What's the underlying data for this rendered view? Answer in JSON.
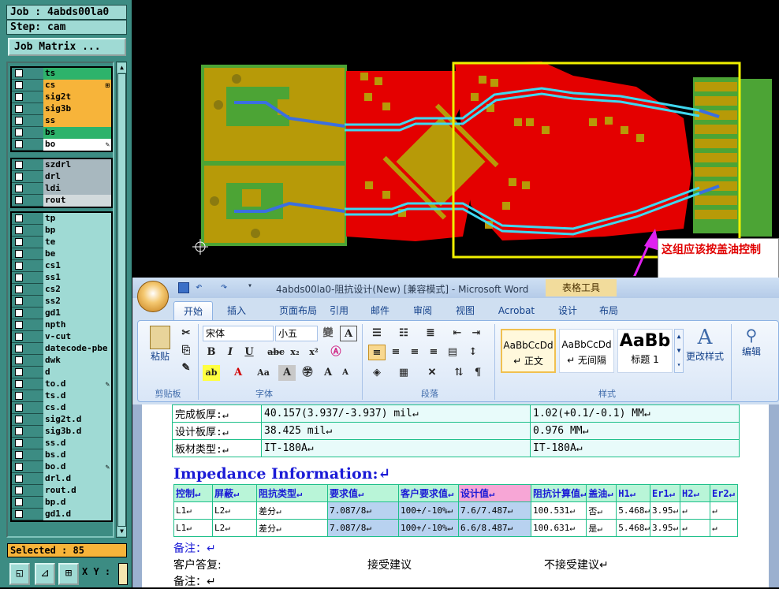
{
  "cam": {
    "job_label": "Job : 4abds00la0",
    "step_label": "Step: cam",
    "job_matrix_label": "Job Matrix ...",
    "layer_groups": [
      [
        {
          "name": "ts",
          "color": "#2db36b",
          "mark": ""
        },
        {
          "name": "cs",
          "color": "#f7b43a",
          "mark": "⊞"
        },
        {
          "name": "sig2t",
          "color": "#f7b43a",
          "mark": ""
        },
        {
          "name": "sig3b",
          "color": "#f7b43a",
          "mark": ""
        },
        {
          "name": "ss",
          "color": "#f7b43a",
          "mark": ""
        },
        {
          "name": "bs",
          "color": "#2db36b",
          "mark": ""
        },
        {
          "name": "bo",
          "color": "#ffffff",
          "mark": "✎"
        }
      ],
      [
        {
          "name": "szdrl",
          "color": "#a8b8bf",
          "mark": ""
        },
        {
          "name": "drl",
          "color": "#a8b8bf",
          "mark": ""
        },
        {
          "name": "ldi",
          "color": "#a8b8bf",
          "mark": ""
        },
        {
          "name": "rout",
          "color": "#d2dadc",
          "mark": ""
        }
      ],
      [
        {
          "name": "tp",
          "color": "#9fdad4",
          "mark": ""
        },
        {
          "name": "bp",
          "color": "#9fdad4",
          "mark": ""
        },
        {
          "name": "te",
          "color": "#9fdad4",
          "mark": ""
        },
        {
          "name": "be",
          "color": "#9fdad4",
          "mark": ""
        },
        {
          "name": "cs1",
          "color": "#9fdad4",
          "mark": ""
        },
        {
          "name": "ss1",
          "color": "#9fdad4",
          "mark": ""
        },
        {
          "name": "cs2",
          "color": "#9fdad4",
          "mark": ""
        },
        {
          "name": "ss2",
          "color": "#9fdad4",
          "mark": ""
        },
        {
          "name": "gd1",
          "color": "#9fdad4",
          "mark": ""
        },
        {
          "name": "npth",
          "color": "#9fdad4",
          "mark": ""
        },
        {
          "name": "v-cut",
          "color": "#9fdad4",
          "mark": ""
        },
        {
          "name": "datecode-pbe",
          "color": "#9fdad4",
          "mark": ""
        },
        {
          "name": "dwk",
          "color": "#9fdad4",
          "mark": ""
        },
        {
          "name": "d",
          "color": "#9fdad4",
          "mark": ""
        },
        {
          "name": "to.d",
          "color": "#9fdad4",
          "mark": "✎"
        },
        {
          "name": "ts.d",
          "color": "#9fdad4",
          "mark": ""
        },
        {
          "name": "cs.d",
          "color": "#9fdad4",
          "mark": ""
        },
        {
          "name": "sig2t.d",
          "color": "#9fdad4",
          "mark": ""
        },
        {
          "name": "sig3b.d",
          "color": "#9fdad4",
          "mark": ""
        },
        {
          "name": "ss.d",
          "color": "#9fdad4",
          "mark": ""
        },
        {
          "name": "bs.d",
          "color": "#9fdad4",
          "mark": ""
        },
        {
          "name": "bo.d",
          "color": "#9fdad4",
          "mark": "✎"
        },
        {
          "name": "drl.d",
          "color": "#9fdad4",
          "mark": ""
        },
        {
          "name": "rout.d",
          "color": "#9fdad4",
          "mark": ""
        },
        {
          "name": "bp.d",
          "color": "#9fdad4",
          "mark": ""
        },
        {
          "name": "gd1.d",
          "color": "#9fdad4",
          "mark": ""
        }
      ]
    ],
    "selected_label": "Selected : 85",
    "xy_label": "X Y :"
  },
  "annotation": {
    "text": "这组应该按盖油控制"
  },
  "word": {
    "title": "4abds00la0-阻抗设计(New) [兼容模式] - Microsoft Word",
    "table_tools": "表格工具",
    "tabs": [
      "开始",
      "插入",
      "页面布局",
      "引用",
      "邮件",
      "审阅",
      "视图",
      "Acrobat",
      "设计",
      "布局"
    ],
    "font_name": "宋体",
    "font_size": "小五",
    "group_labels": {
      "clipboard": "剪贴板",
      "font": "字体",
      "paragraph": "段落",
      "styles": "样式"
    },
    "paste_label": "粘贴",
    "styles": [
      {
        "preview": "AaBbCcDd",
        "name": "↵ 正文"
      },
      {
        "preview": "AaBbCcDd",
        "name": "↵ 无间隔"
      },
      {
        "preview": "AaBb",
        "name": "标题 1"
      }
    ],
    "change_styles": "更改样式",
    "edit": "编辑"
  },
  "doc": {
    "board_rows": [
      [
        "完成板厚:↵",
        "40.157(3.937/-3.937) mil↵",
        "1.02(+0.1/-0.1) MM↵"
      ],
      [
        "设计板厚:↵",
        "38.425 mil↵",
        "0.976 MM↵"
      ],
      [
        "板材类型:↵",
        "IT-180A↵",
        "IT-180A↵"
      ]
    ],
    "impedance_heading": "Impedance Information:↵",
    "imp_headers": [
      "控制↵",
      "屏蔽↵",
      "阻抗类型↵",
      "要求值↵",
      "客户要求值↵",
      "设计值↵",
      "阻抗计算值↵",
      "盖油↵",
      "H1↵",
      "Er1↵",
      "H2↵",
      "Er2↵"
    ],
    "imp_rows": [
      [
        "L1↵",
        "L2↵",
        "差分↵",
        "7.087/8↵",
        "100+/-10%↵",
        "7.6/7.487↵",
        "100.531↵",
        "否↵",
        "5.468↵",
        "3.95↵",
        "↵",
        "↵"
      ],
      [
        "L1↵",
        "L2↵",
        "差分↵",
        "7.087/8↵",
        "100+/-10%↵",
        "6.6/8.487↵",
        "100.631↵",
        "是↵",
        "5.468↵",
        "3.95↵",
        "↵",
        "↵"
      ]
    ],
    "note1": "备注：↵",
    "reply_label": "客户答复:",
    "accept": "接受建议",
    "reject": "不接受建议↵",
    "note2": "备注：↵"
  }
}
